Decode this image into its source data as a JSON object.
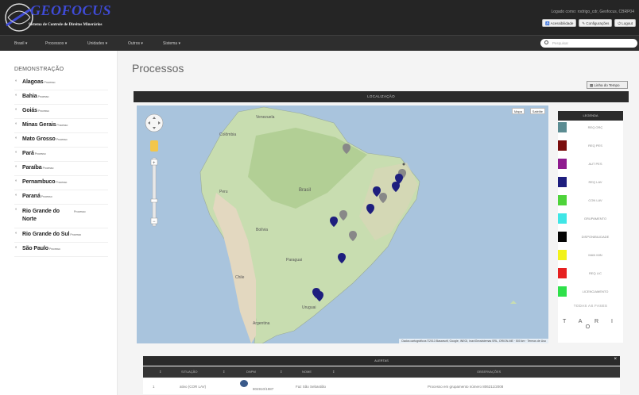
{
  "app": {
    "brand": "GEOFOCUS",
    "subtitle": "Sistema de Controle de Direitos Minerários",
    "logged_in": "Logado como: rodrigo_cdr, Geofocus, CBRP04",
    "buttons": [
      "Acessibilidade",
      "Configurações",
      "Logout"
    ]
  },
  "nav": {
    "items": [
      "Brasil ▾",
      "Processos ▾",
      "Unidades ▾",
      "Outros ▾",
      "Sistema ▾"
    ],
    "search_placeholder": "Pesquisar"
  },
  "sidebar": {
    "title": "DEMONSTRAÇÃO",
    "items": [
      {
        "name": "Alagoas",
        "tag": "Processo"
      },
      {
        "name": "Bahia",
        "tag": "Processo"
      },
      {
        "name": "Goiás",
        "tag": "Processo"
      },
      {
        "name": "Minas Gerais",
        "tag": "Processo"
      },
      {
        "name": "Mato Grosso",
        "tag": "Processo"
      },
      {
        "name": "Pará",
        "tag": "Processo"
      },
      {
        "name": "Paraíba",
        "tag": "Processo"
      },
      {
        "name": "Pernambuco",
        "tag": "Processo"
      },
      {
        "name": "Paraná",
        "tag": "Processo"
      },
      {
        "name": "Rio Grande do Norte",
        "tag": "Processo"
      },
      {
        "name": "Rio Grande do Sul",
        "tag": "Processo"
      },
      {
        "name": "São Paulo",
        "tag": "Processo"
      }
    ]
  },
  "main": {
    "title": "Processos",
    "linha_tempo": "Linha do Tempo",
    "localizacao": "LOCALIZAÇÃO",
    "map_types": [
      "Mapa",
      "Satélite"
    ],
    "map_credits": "Dados cartográficos ©2013 Basarsoft, Google, INEGI, Inav/Geosistemas SRL, ORION-ME · 500 km · Termos de Uso",
    "map_labels": [
      "Venezuela",
      "Colômbia",
      "Peru",
      "Bolívia",
      "Brasil",
      "Paraguai",
      "Chile",
      "Argentina",
      "Uruguai"
    ]
  },
  "legend": {
    "title": "LEGENDA",
    "items": [
      {
        "label": "REQ ORÇ",
        "color": "#5b8c92"
      },
      {
        "label": "REQ PES",
        "color": "#7a0d0d"
      },
      {
        "label": "AUT PES",
        "color": "#8e1b8e"
      },
      {
        "label": "REQ LAV",
        "color": "#1e1e7e"
      },
      {
        "label": "CON LAV",
        "color": "#4ed33a"
      },
      {
        "label": "GRUPAMENTO",
        "color": "#3fe6e6"
      },
      {
        "label": "DISPONIBILIDADE",
        "color": "#050505"
      },
      {
        "label": "MAN MIN",
        "color": "#f2f21a"
      },
      {
        "label": "REQ LIC",
        "color": "#e62020"
      },
      {
        "label": "LICENCIAMENTO",
        "color": "#2ee04a"
      }
    ],
    "all_phases": "TODAS AS FASES",
    "tabs": "T A R I O"
  },
  "alerts": {
    "title": "ALERTAS",
    "columns": [
      "SITUAÇÃO",
      "DNPM",
      "NOME",
      "OBSERVAÇÕES"
    ],
    "row": {
      "idx": "1",
      "situacao": "ativo (COR LAV)",
      "dnpm": "804910/1987",
      "nome": "Faz São Sebastião",
      "obs": "Processo em grupamento número 806211/2008"
    }
  }
}
